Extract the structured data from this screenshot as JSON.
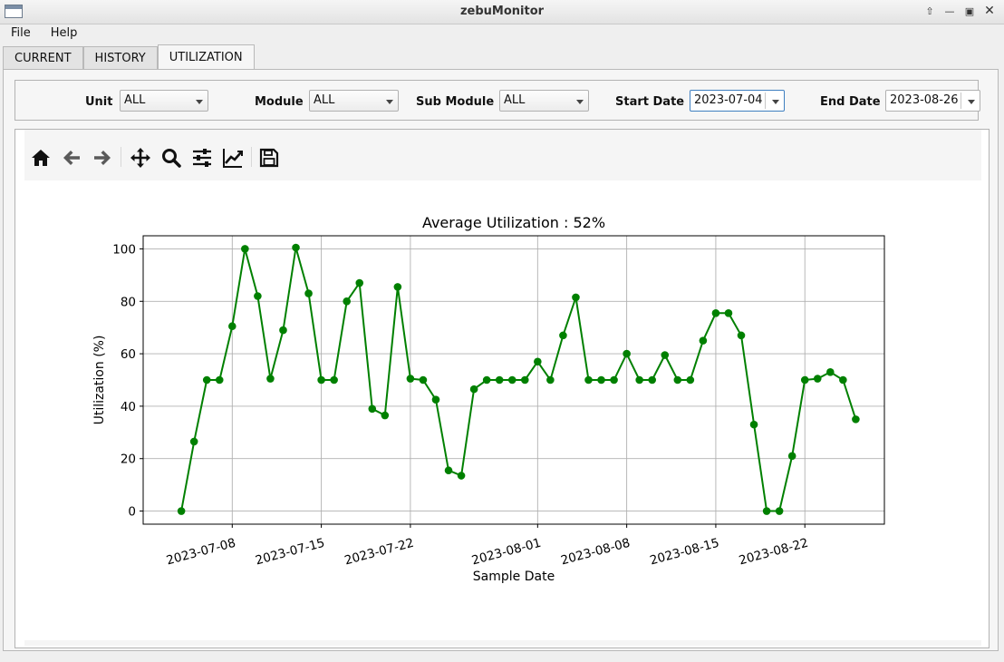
{
  "window": {
    "title": "zebuMonitor"
  },
  "menu": {
    "file": "File",
    "help": "Help"
  },
  "tabs": [
    {
      "label": "CURRENT"
    },
    {
      "label": "HISTORY"
    },
    {
      "label": "UTILIZATION",
      "active": true
    }
  ],
  "filters": {
    "unit": {
      "label": "Unit",
      "value": "ALL"
    },
    "module": {
      "label": "Module",
      "value": "ALL"
    },
    "sub_module": {
      "label": "Sub Module",
      "value": "ALL"
    },
    "start_date": {
      "label": "Start Date",
      "value": "2023-07-04"
    },
    "end_date": {
      "label": "End Date",
      "value": "2023-08-26"
    }
  },
  "toolbar_icons": [
    "home-icon",
    "back-arrow-icon",
    "forward-arrow-icon",
    "pan-icon",
    "zoom-icon",
    "configure-subplots-icon",
    "edit-axis-icon",
    "save-icon"
  ],
  "chart_data": {
    "type": "line",
    "title": "Average Utilization : 52%",
    "xlabel": "Sample Date",
    "ylabel": "Utilization (%)",
    "color": "#008000",
    "grid": true,
    "ylim": [
      -5,
      105
    ],
    "yticks": [
      0,
      20,
      40,
      60,
      80,
      100
    ],
    "xlim": [
      "2023-07-01",
      "2023-08-26"
    ],
    "xticks": [
      "2023-07-08",
      "2023-07-15",
      "2023-07-22",
      "2023-08-01",
      "2023-08-08",
      "2023-08-15",
      "2023-08-22"
    ],
    "series": [
      {
        "x": [
          "2023-07-04",
          "2023-07-05",
          "2023-07-06",
          "2023-07-07",
          "2023-07-08",
          "2023-07-09",
          "2023-07-10",
          "2023-07-11",
          "2023-07-12",
          "2023-07-13",
          "2023-07-14",
          "2023-07-15",
          "2023-07-16",
          "2023-07-17",
          "2023-07-18",
          "2023-07-19",
          "2023-07-20",
          "2023-07-21",
          "2023-07-22",
          "2023-07-23",
          "2023-07-24",
          "2023-07-25",
          "2023-07-26",
          "2023-07-27",
          "2023-07-28",
          "2023-07-29",
          "2023-07-30",
          "2023-07-31",
          "2023-08-01",
          "2023-08-02",
          "2023-08-03",
          "2023-08-04",
          "2023-08-05",
          "2023-08-06",
          "2023-08-07",
          "2023-08-08",
          "2023-08-09",
          "2023-08-10",
          "2023-08-11",
          "2023-08-12",
          "2023-08-13",
          "2023-08-14",
          "2023-08-15",
          "2023-08-16",
          "2023-08-17",
          "2023-08-18",
          "2023-08-19",
          "2023-08-20",
          "2023-08-21",
          "2023-08-22",
          "2023-08-23",
          "2023-08-24",
          "2023-08-25",
          "2023-08-26"
        ],
        "values": [
          0,
          26.5,
          50,
          50,
          70.5,
          100,
          82,
          50.5,
          69,
          100.5,
          83,
          50,
          50,
          80,
          87,
          39,
          36.5,
          85.5,
          50.5,
          50,
          42.5,
          15.5,
          13.5,
          46.5,
          50,
          50,
          50,
          50,
          57,
          50,
          67,
          81.5,
          50,
          50,
          50,
          60,
          50,
          50,
          59.5,
          50,
          50,
          65,
          75.5,
          75.5,
          67,
          33,
          0,
          0,
          21,
          50,
          50.5,
          53,
          50,
          35
        ]
      }
    ]
  }
}
